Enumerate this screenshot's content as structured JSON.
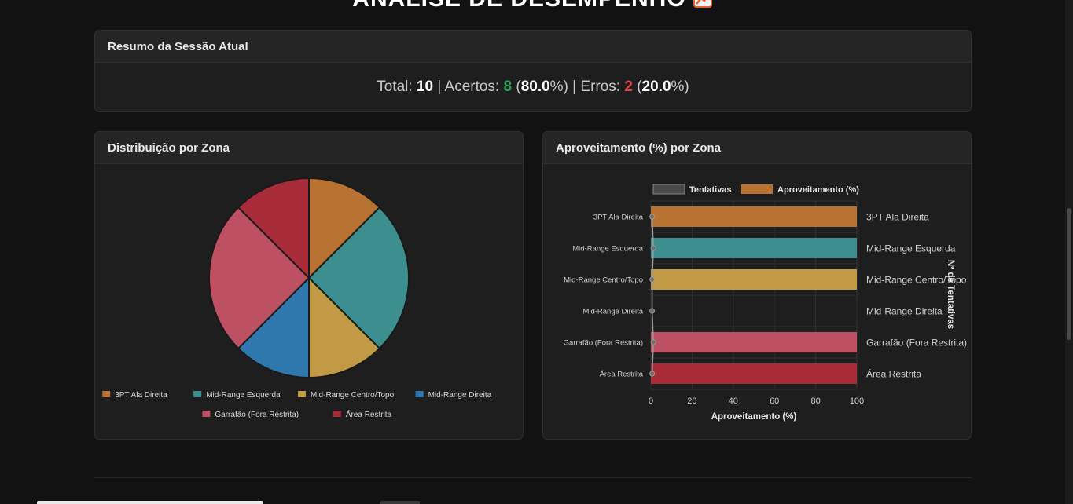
{
  "page": {
    "title": "ANÁLISE DE DESEMPENHO",
    "title_icon": "chart-increasing-icon"
  },
  "summary": {
    "header": "Resumo da Sessão Atual",
    "total_label": "Total:",
    "total": "10",
    "hits_label": "Acertos:",
    "hits": "8",
    "hits_pct": "80.0",
    "errors_label": "Erros:",
    "errors": "2",
    "errors_pct": "20.0",
    "separator": "|"
  },
  "pie_card": {
    "header": "Distribuição por Zona"
  },
  "bar_card": {
    "header": "Aproveitamento (%) por Zona"
  },
  "colors": {
    "3PT Ala Direita": "#b87333",
    "Mid-Range Esquerda": "#3d8f8f",
    "Mid-Range Centro/Topo": "#c29a45",
    "Mid-Range Direita": "#2e78ad",
    "Garrafão (Fora Restrita)": "#be5064",
    "Área Restrita": "#a82b39",
    "tentativas_legend": "#4a4a4a"
  },
  "chart_data": [
    {
      "type": "pie",
      "title": "",
      "categories": [
        "3PT Ala Direita",
        "Mid-Range Esquerda",
        "Mid-Range Centro/Topo",
        "Mid-Range Direita",
        "Garrafão (Fora Restrita)",
        "Área Restrita"
      ],
      "values": [
        1,
        2,
        1,
        1,
        2,
        1
      ],
      "legend": "bottom"
    },
    {
      "type": "bar",
      "orientation": "horizontal",
      "title": "",
      "categories": [
        "3PT Ala Direita",
        "Mid-Range Esquerda",
        "Mid-Range Centro/Topo",
        "Mid-Range Direita",
        "Garrafão (Fora Restrita)",
        "Área Restrita"
      ],
      "series": [
        {
          "name": "Tentativas",
          "type": "line",
          "values": [
            1,
            2,
            1,
            1,
            2,
            1
          ]
        },
        {
          "name": "Aproveitamento (%)",
          "type": "bar",
          "values": [
            100,
            100,
            100,
            0,
            100,
            100
          ]
        }
      ],
      "xlabel": "Aproveitamento (%)",
      "y2label": "Nº de Tentativas",
      "xlim": [
        0,
        100
      ],
      "xticks": [
        "0",
        "20",
        "40",
        "60",
        "80",
        "100"
      ],
      "legend": "top",
      "grid": true
    }
  ]
}
